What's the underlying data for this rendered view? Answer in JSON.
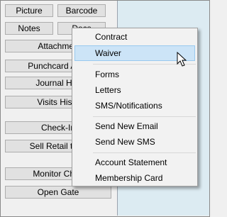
{
  "buttons": {
    "picture": "Picture",
    "barcode": "Barcode",
    "notes": "Notes",
    "docs": "Docs",
    "attachments": "Attachmen",
    "punchcard": "Punchcard Add-",
    "journal_history": "Journal Hist",
    "visits_history": "Visits Histo",
    "check_in": "Check-In",
    "sell_retail": "Sell Retail to M",
    "monitor_check": "Monitor Chec",
    "open_gate": "Open Gate"
  },
  "menu": {
    "items": [
      "Contract",
      "Waiver",
      "Forms",
      "Letters",
      "SMS/Notifications",
      "Send New Email",
      "Send New SMS",
      "Account Statement",
      "Membership Card"
    ],
    "hovered": "Waiver"
  },
  "colors": {
    "menu_hover_bg": "#cce4f7",
    "right_panel_bg": "#dcebf2"
  }
}
